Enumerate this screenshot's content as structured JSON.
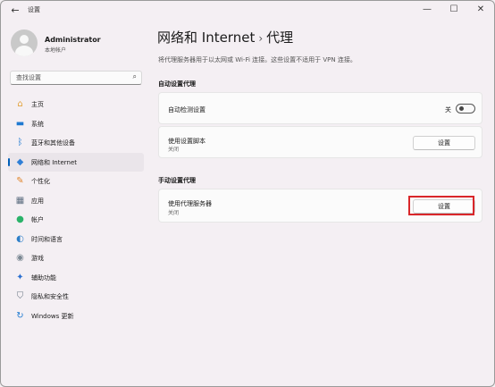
{
  "window": {
    "title": "设置",
    "back_icon": "←",
    "minimize_icon": "—",
    "maximize_icon": "☐",
    "close_icon": "✕"
  },
  "user": {
    "name": "Administrator",
    "subtitle": "本地帐户"
  },
  "search": {
    "placeholder": "查找设置",
    "icon": "⌕"
  },
  "sidebar": {
    "items": [
      {
        "label": "主页",
        "icon": "home-icon",
        "glyph": "⌂",
        "color": "#e3a23b"
      },
      {
        "label": "系统",
        "icon": "monitor-icon",
        "glyph": "▬",
        "color": "#1f7ad1"
      },
      {
        "label": "蓝牙和其他设备",
        "icon": "bluetooth-icon",
        "glyph": "ᛒ",
        "color": "#1f7ad1"
      },
      {
        "label": "网络和 Internet",
        "icon": "wifi-icon",
        "glyph": "◆",
        "color": "#2f7fd6"
      },
      {
        "label": "个性化",
        "icon": "brush-icon",
        "glyph": "✎",
        "color": "#e0852b"
      },
      {
        "label": "应用",
        "icon": "apps-icon",
        "glyph": "▦",
        "color": "#5d6e80"
      },
      {
        "label": "帐户",
        "icon": "account-icon",
        "glyph": "●",
        "color": "#2bb36a"
      },
      {
        "label": "时间和语言",
        "icon": "globe-icon",
        "glyph": "◐",
        "color": "#2c7ec8"
      },
      {
        "label": "游戏",
        "icon": "gamepad-icon",
        "glyph": "◉",
        "color": "#7b8893"
      },
      {
        "label": "辅助功能",
        "icon": "accessibility-icon",
        "glyph": "✦",
        "color": "#2a6fd0"
      },
      {
        "label": "隐私和安全性",
        "icon": "shield-icon",
        "glyph": "⛉",
        "color": "#6c7884"
      },
      {
        "label": "Windows 更新",
        "icon": "update-icon",
        "glyph": "↻",
        "color": "#1f7ad1"
      }
    ],
    "active_index": 3
  },
  "page": {
    "breadcrumb_parent": "网络和 Internet",
    "breadcrumb_sep": "›",
    "breadcrumb_current": "代理",
    "description": "将代理服务器用于以太网或 Wi-Fi 连接。这些设置不适用于 VPN 连接。"
  },
  "auto_proxy": {
    "section_title": "自动设置代理",
    "detect_label": "自动检测设置",
    "detect_state": "关",
    "detect_on": false,
    "script_label": "使用设置脚本",
    "script_sub": "关闭",
    "script_button": "设置"
  },
  "manual_proxy": {
    "section_title": "手动设置代理",
    "server_label": "使用代理服务器",
    "server_sub": "关闭",
    "server_button": "设置"
  },
  "colors": {
    "accent": "#005fb8",
    "highlight": "#d9262a"
  }
}
